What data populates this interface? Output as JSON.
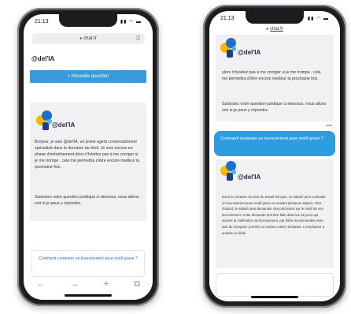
{
  "phone_left": {
    "status_time": "21:13",
    "status_icons": "▮▮ ◠ ▬",
    "url": "chat.fr",
    "brand_title": "@del'IA",
    "new_question_label": "+ Nouvelle question",
    "bot_name": "@del'IA",
    "intro_text": "Bonjour, je suis @del'IA, un jeune agent conversationnel spécialisé dans le domaine du droit. Je suis encore en phase d'entraînement alors n'hésitez pas à me corriger si je me trompe , cela me permettra d'être encore meilleur la prochaine fois .",
    "prompt_text": "Saisissez votre question juridique ci-dessous, nous allons voir si je peux y répondre.",
    "question_text": "Comment contester un licenciement pour motif grave ?",
    "nav_icons": [
      "←",
      "→",
      "+",
      "⧉"
    ]
  },
  "phone_right": {
    "status_time": "21:13",
    "status_icons": "▮▮ ◠ ▬",
    "url": "chat.fr",
    "bot_name_top": "@del'IA",
    "intro_continued": "alors n'hésitez pas à me corriger si je me trompe , cela me permettra d'être encore meilleur la prochaine fois.",
    "prompt_text": "Saisissez votre question juridique ci-dessous, nous allons voir si je peux y répondre.",
    "user_question": "Comment contester un licenciement pour motif grave ?",
    "bot_name_answer": "@del'IA",
    "answer_text": "Dans le contexte du droit du travail français, un salarié peut contester un licenciement pour motif grave en suivant plusieurs étapes. Tout d'abord, le salarié peut demander des précisions sur le motif de son licenciement. Cette demande doit être faite dans les 15 jours qui suivent la notification du licenciement, par lettre recommandée avec avis de réception (LRAR) ou remise contre récépissé. L'employeur a ensuite un délai"
  }
}
